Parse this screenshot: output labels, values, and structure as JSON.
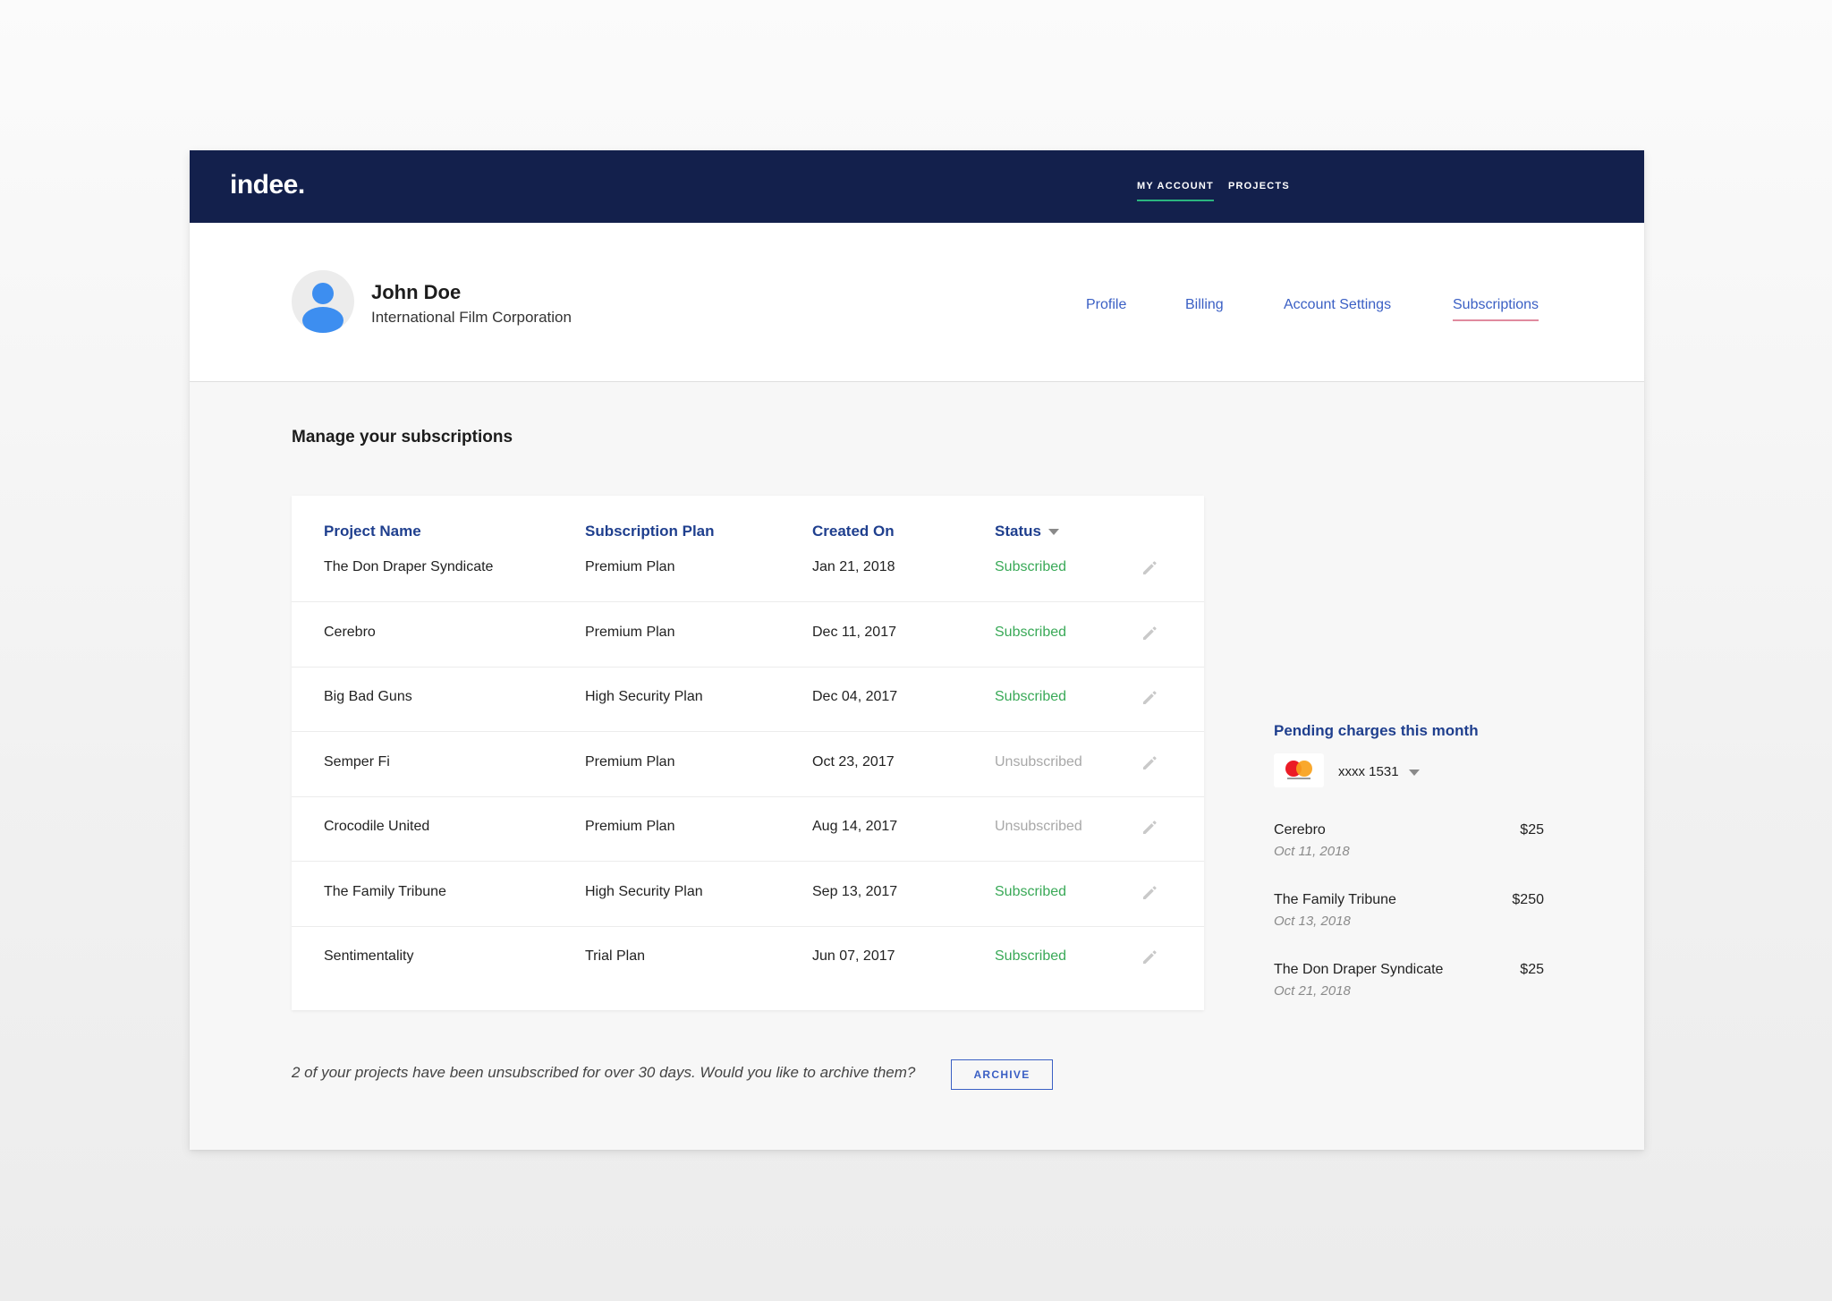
{
  "brand": {
    "logo": "indee."
  },
  "topnav": [
    {
      "label": "MY ACCOUNT",
      "active": true
    },
    {
      "label": "PROJECTS",
      "active": false
    }
  ],
  "user": {
    "name": "John Doe",
    "org": "International Film Corporation",
    "avatar_icon": "user-icon"
  },
  "tabs": [
    {
      "label": "Profile",
      "active": false
    },
    {
      "label": "Billing",
      "active": false
    },
    {
      "label": "Account Settings",
      "active": false
    },
    {
      "label": "Subscriptions",
      "active": true
    }
  ],
  "section_title": "Manage your subscriptions",
  "table": {
    "columns": [
      "Project Name",
      "Subscription Plan",
      "Created On",
      "Status"
    ],
    "rows": [
      {
        "project": "The Don Draper Syndicate",
        "plan": "Premium Plan",
        "created": "Jan 21, 2018",
        "status": "Subscribed",
        "subscribed": true
      },
      {
        "project": "Cerebro",
        "plan": "Premium Plan",
        "created": "Dec 11, 2017",
        "status": "Subscribed",
        "subscribed": true
      },
      {
        "project": "Big Bad Guns",
        "plan": "High Security Plan",
        "created": "Dec 04, 2017",
        "status": "Subscribed",
        "subscribed": true
      },
      {
        "project": "Semper Fi",
        "plan": "Premium Plan",
        "created": "Oct 23, 2017",
        "status": "Unsubscribed",
        "subscribed": false
      },
      {
        "project": "Crocodile United",
        "plan": "Premium Plan",
        "created": "Aug 14, 2017",
        "status": "Unsubscribed",
        "subscribed": false
      },
      {
        "project": "The Family Tribune",
        "plan": "High Security Plan",
        "created": "Sep 13, 2017",
        "status": "Subscribed",
        "subscribed": true
      },
      {
        "project": "Sentimentality",
        "plan": "Trial Plan",
        "created": "Jun 07, 2017",
        "status": "Subscribed",
        "subscribed": true
      }
    ]
  },
  "footer": {
    "note": "2 of your projects have been unsubscribed for over 30 days. Would you like to  archive them?",
    "archive_label": "ARCHIVE"
  },
  "pending": {
    "title": "Pending charges this month",
    "card_number": "xxxx 1531",
    "card_brand": "mastercard",
    "charges": [
      {
        "name": "Cerebro",
        "date": "Oct 11, 2018",
        "amount": "$25"
      },
      {
        "name": "The Family Tribune",
        "date": "Oct 13, 2018",
        "amount": "$250"
      },
      {
        "name": "The Don Draper Syndicate",
        "date": "Oct 21, 2018",
        "amount": "$25"
      }
    ]
  },
  "colors": {
    "navbar": "#13204c",
    "accent_blue": "#3a5fc4",
    "heading_blue": "#1f3f8e",
    "subscribed_green": "#39a957",
    "unsubscribed_gray": "#a8a8a8",
    "active_tab_underline": "#e08a9e",
    "active_nav_underline": "#2bb57f"
  }
}
